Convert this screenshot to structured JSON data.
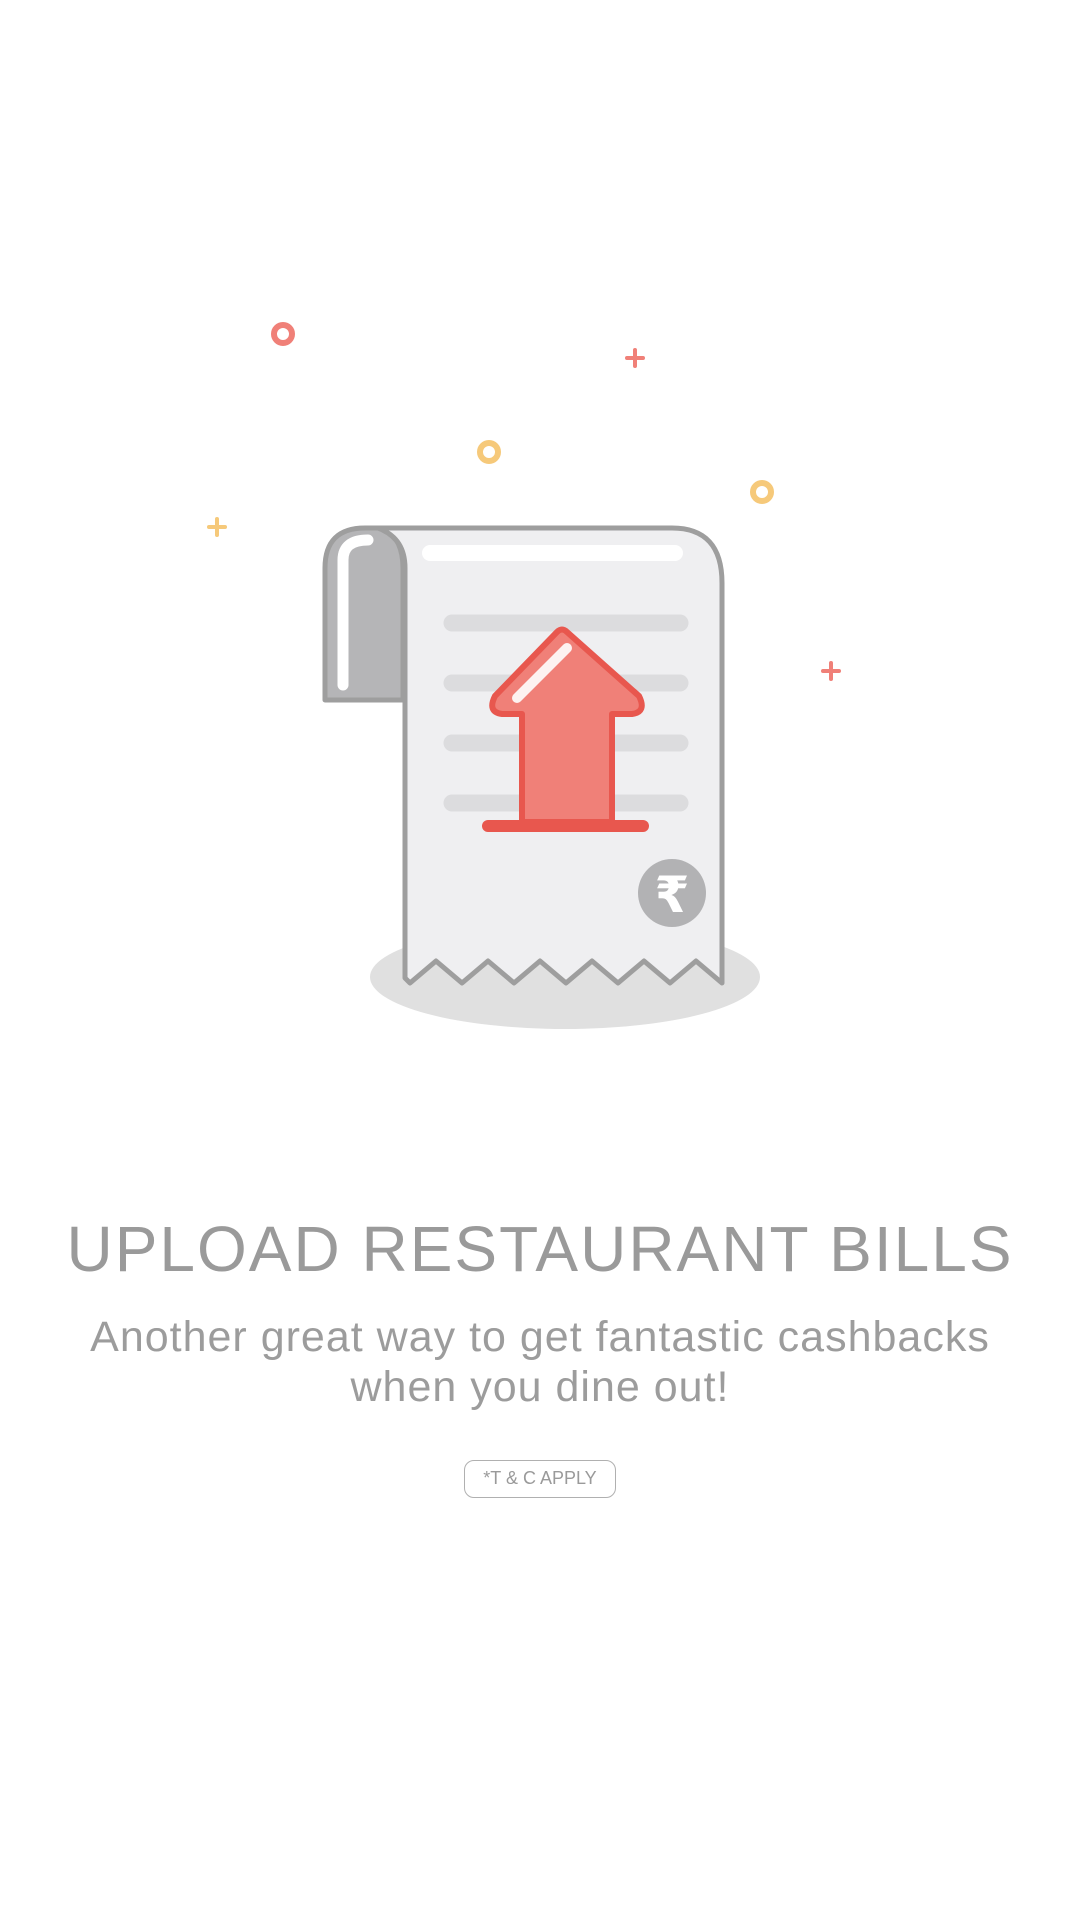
{
  "onboarding": {
    "title": "UPLOAD RESTAURANT BILLS",
    "subtitle": "Another great way to get fantastic cashbacks when you dine out!",
    "tnc_label": "*T & C APPLY"
  },
  "illustration": {
    "icon": "receipt-upload-icon",
    "currency_glyph": "₹",
    "colors": {
      "accent_red": "#f08078",
      "accent_red_dark": "#e8574e",
      "accent_yellow": "#f6c97a",
      "receipt_fill": "#efeff1",
      "receipt_stroke": "#9e9e9e",
      "shadow": "#e0e0e0"
    }
  }
}
